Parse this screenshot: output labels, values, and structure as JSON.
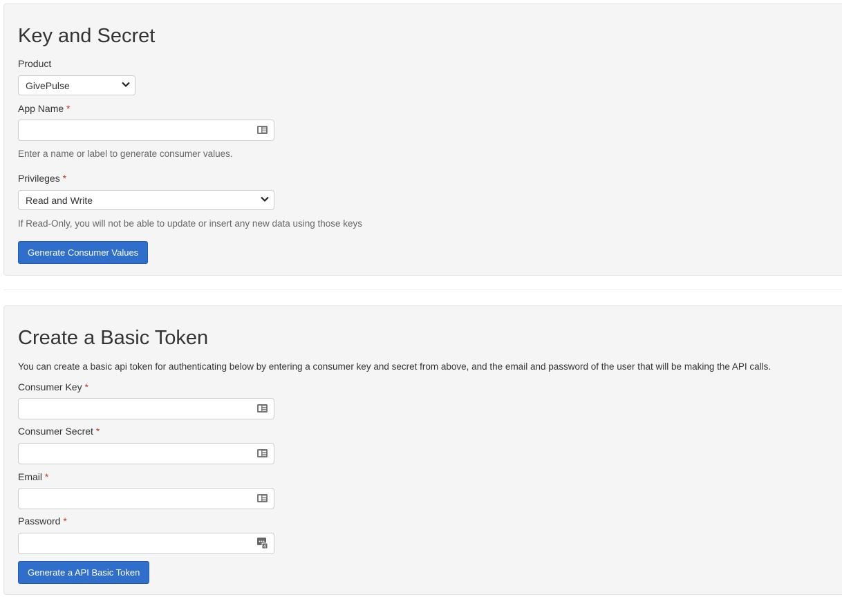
{
  "key_secret": {
    "title": "Key and Secret",
    "product_label": "Product",
    "product_value": "GivePulse",
    "app_name_label": "App Name",
    "app_name_value": "",
    "app_name_help": "Enter a name or label to generate consumer values.",
    "privileges_label": "Privileges",
    "privileges_value": "Read and Write",
    "privileges_help": "If Read-Only, you will not be able to update or insert any new data using those keys",
    "generate_button": "Generate Consumer Values",
    "required_mark": "*"
  },
  "basic_token": {
    "title": "Create a Basic Token",
    "description": "You can create a basic api token for authenticating below by entering a consumer key and secret from above, and the email and password of the user that will be making the API calls.",
    "consumer_key_label": "Consumer Key",
    "consumer_secret_label": "Consumer Secret",
    "email_label": "Email",
    "password_label": "Password",
    "generate_button": "Generate a API Basic Token",
    "required_mark": "*"
  },
  "colors": {
    "primary": "#2f6fcb",
    "panel_bg": "#f5f5f5",
    "required": "#c0392b"
  }
}
